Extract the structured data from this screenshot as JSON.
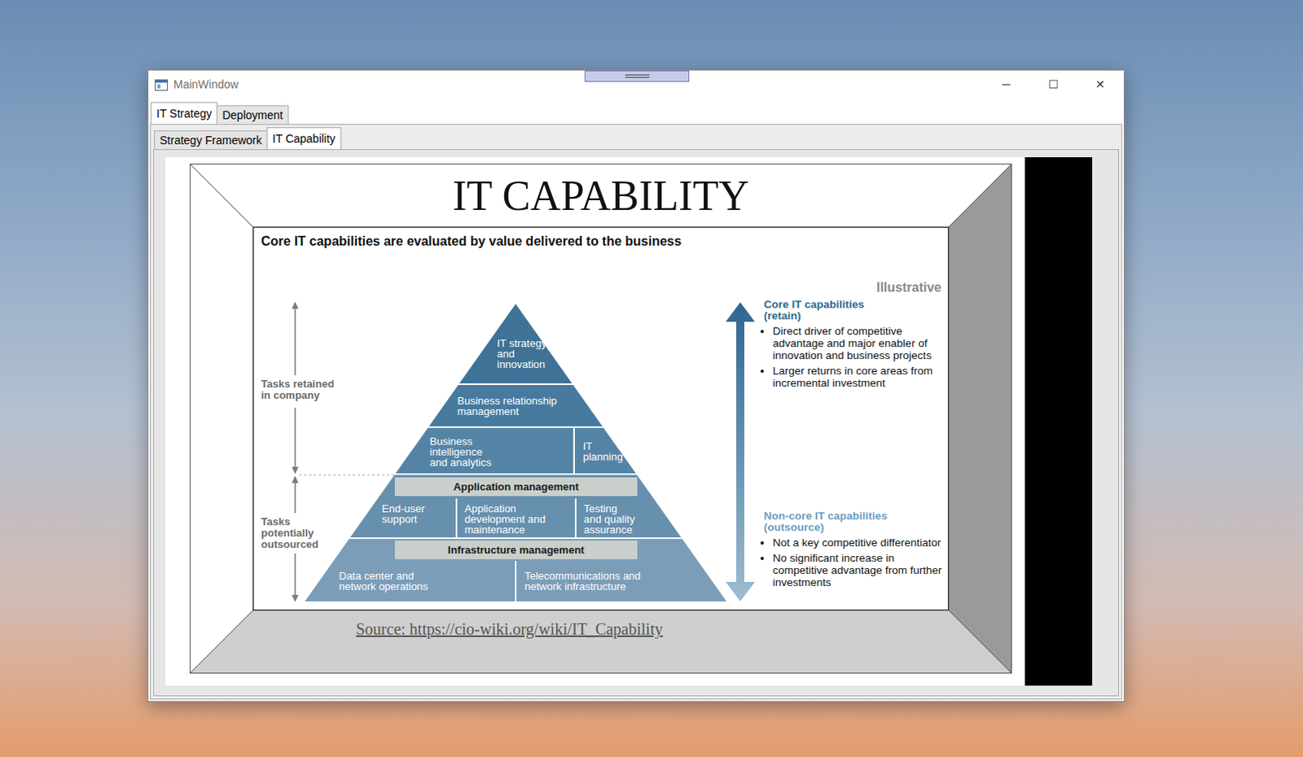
{
  "window": {
    "title": "MainWindow",
    "controls": [
      "─",
      "☐",
      "✕"
    ]
  },
  "tabs": [
    {
      "label": "IT Strategy",
      "selected": true
    },
    {
      "label": "Deployment",
      "selected": false
    }
  ],
  "subtabs": [
    {
      "label": "Strategy Framework",
      "selected": false
    },
    {
      "label": "IT Capability",
      "selected": true
    }
  ],
  "slide": {
    "title": "IT CAPABILITY",
    "source": "Source: https://cio-wiki.org/wiki/IT_Capability",
    "figure": {
      "heading": "Core IT capabilities are evaluated by value delivered to the business",
      "note": "Illustrative",
      "scale_labels": [
        "Tasks retained in company",
        "Tasks potentially outsourced"
      ],
      "pyramid": {
        "apex": "IT strategy and innovation",
        "relationship": "Business relationship management",
        "middle": [
          "Business intelligence and analytics",
          "IT planning"
        ],
        "tiers": [
          {
            "header": "Application management",
            "cells": [
              "End-user support",
              "Application development and maintenance",
              "Testing and quality assurance"
            ]
          },
          {
            "header": "Infrastructure management",
            "cells": [
              "Data center and network operations",
              "Telecommunications and network infrastructure"
            ]
          }
        ]
      },
      "groups": [
        {
          "title": "Core IT capabilities",
          "qualifier": "(retain)",
          "color": "#2e6891",
          "bullets": [
            "Direct driver of competitive advantage and major enabler of innovation and business projects",
            "Larger returns in core areas from incremental investment"
          ]
        },
        {
          "title": "Non-core IT capabilities",
          "qualifier": "(outsource)",
          "color": "#6d9cc0",
          "bullets": [
            "Not a key competitive differentiator",
            "No significant increase in competitive advantage from further investments"
          ]
        }
      ]
    }
  }
}
